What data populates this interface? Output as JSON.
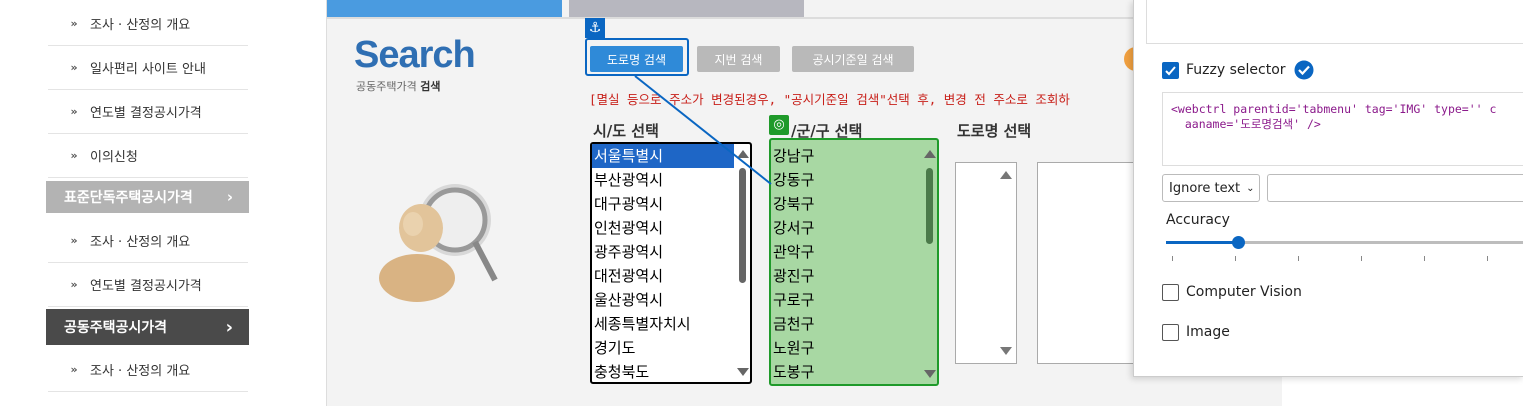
{
  "sidebar": {
    "items_top": [
      {
        "label": "조사 · 산정의 개요"
      },
      {
        "label": "일사편리 사이트 안내"
      },
      {
        "label": "연도별 결정공시가격"
      },
      {
        "label": "이의신청"
      }
    ],
    "section1": {
      "label": "표준단독주택공시가격",
      "arrow": "›"
    },
    "items_mid": [
      {
        "label": "조사 · 산정의 개요"
      },
      {
        "label": "연도별 결정공시가격"
      }
    ],
    "section2": {
      "label": "공동주택공시가격",
      "arrow": "›"
    },
    "items_bottom": [
      {
        "label": "조사 · 산정의 개요"
      }
    ],
    "chevron": "»"
  },
  "search": {
    "logo": "Search",
    "subtitle_plain": "공동주택가격 ",
    "subtitle_bold": "검색",
    "buttons": {
      "road": "도로명 검색",
      "lot": "지번 검색",
      "date": "공시기준일 검색"
    },
    "notice": "[멸실 등으로 주소가 변경된경우, \"공시기준일 검색\"선택 후, 변경 전 주소로 조회하",
    "headers": {
      "sido": "시/도 선택",
      "gungu": "/군/구 선택",
      "road": "도로명 선택"
    },
    "sido_options": [
      "서울특별시",
      "부산광역시",
      "대구광역시",
      "인천광역시",
      "광주광역시",
      "대전광역시",
      "울산광역시",
      "세종특별자치시",
      "경기도",
      "충청북도"
    ],
    "gungu_options": [
      "강남구",
      "강동구",
      "강북구",
      "강서구",
      "관악구",
      "광진구",
      "구로구",
      "금천구",
      "노원구",
      "도봉구"
    ]
  },
  "panel": {
    "fuzzy_label": "Fuzzy selector",
    "selector_code_line1": "<webctrl parentid='tabmenu' tag='IMG' type='' c",
    "selector_code_line2": "  aaname='도로명검색' />",
    "ignore_text": "Ignore text",
    "accuracy_label": "Accuracy",
    "accuracy_fraction": 0.2,
    "cv_label": "Computer Vision",
    "image_label": "Image"
  },
  "colors": {
    "accent": "#0a66c2",
    "btn_active": "#2f8ad8",
    "btn_gray": "#b9b9b9",
    "green_fill": "#a8d8a3",
    "green_border": "#1f9a2a",
    "sidebar_head1": "#b3b3b3",
    "sidebar_head2": "#4a4a4a",
    "notice_red": "#c8201a"
  }
}
